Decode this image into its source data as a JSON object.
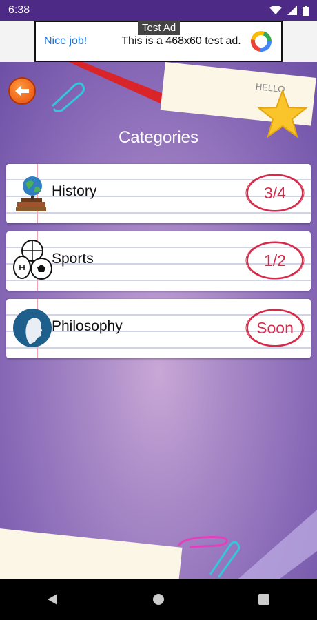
{
  "status": {
    "time": "6:38"
  },
  "ad": {
    "tag": "Test Ad",
    "nice": "Nice job!",
    "text": "This is a 468x60 test ad."
  },
  "screen": {
    "title": "Categories"
  },
  "categories": [
    {
      "label": "History",
      "progress": "3/4",
      "icon": "globe-books-icon"
    },
    {
      "label": "Sports",
      "progress": "1/2",
      "icon": "sports-balls-icon"
    },
    {
      "label": "Philosophy",
      "progress": "Soon",
      "icon": "philosopher-head-icon"
    }
  ],
  "decor": {
    "notebook_text": "HELLO"
  },
  "colors": {
    "status_bar": "#4d2a86",
    "accent_red": "#d52b4a",
    "background": "#8a6bb8"
  }
}
